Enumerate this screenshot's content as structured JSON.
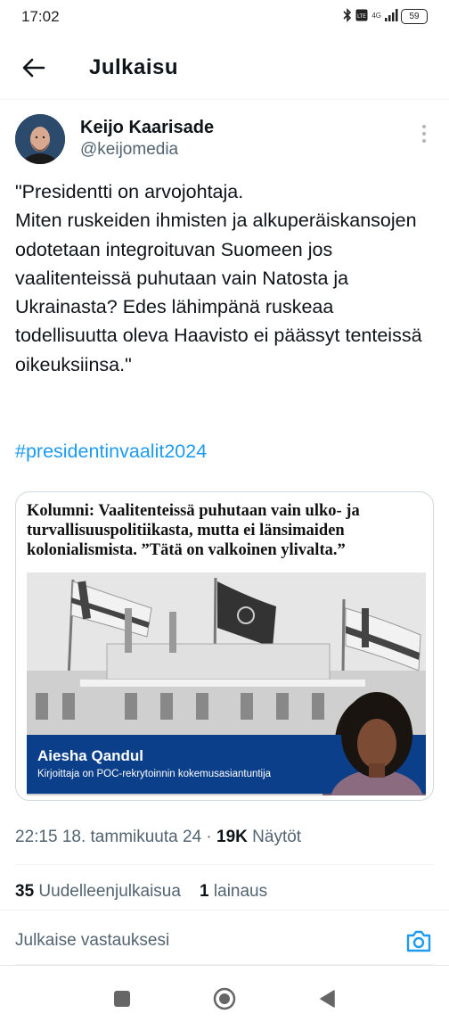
{
  "status_bar": {
    "time": "17:02",
    "battery": "59",
    "network": "4G"
  },
  "header": {
    "title": "Julkaisu"
  },
  "post": {
    "author_name": "Keijo Kaarisade",
    "author_handle": "@keijomedia",
    "text": "\"Presidentti on arvojohtaja.\nMiten ruskeiden ihmisten ja alkuperäiskansojen odotetaan integroituvan Suomeen jos vaalitenteissä puhutaan vain Natosta ja Ukrainasta? Edes lähimpänä ruskeaa todellisuutta oleva Haavisto ei päässyt tenteissä oikeuksiinsa.\"",
    "hashtag": "#presidentinvaalit2024"
  },
  "card": {
    "headline": "Kolumni: Vaalitenteissä puhutaan vain ulko- ja turvallisuuspolitiikasta, mutta ei länsimaiden kolonialismista. ”Tätä on valkoinen ylivalta.”",
    "banner_name": "Aiesha Qandul",
    "banner_subtitle": "Kirjoittaja on POC-rekrytoinnin kokemusasiantuntija"
  },
  "meta": {
    "time": "22:15",
    "date": "18. tammikuuta 24",
    "separator": "·",
    "views_count": "19K",
    "views_label": "Näytöt"
  },
  "stats": {
    "reposts_count": "35",
    "reposts_label": "Uudelleenjulkaisua",
    "quotes_count": "1",
    "quotes_label": "lainaus"
  },
  "reply": {
    "placeholder": "Julkaise vastauksesi"
  },
  "colors": {
    "link": "#1d9bf0",
    "secondary_text": "#536471",
    "banner": "#0b3f8a"
  }
}
